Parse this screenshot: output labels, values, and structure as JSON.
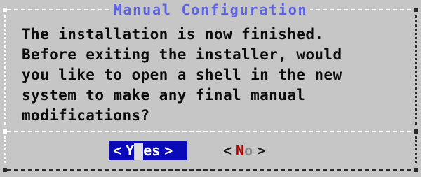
{
  "dialog": {
    "title": "Manual Configuration",
    "message": "The installation is now finished.\nBefore exiting the installer, would\nyou like to open a shell in the new\nsystem to make any final manual\nmodifications?"
  },
  "buttons": {
    "yes": {
      "left_bracket": "<",
      "hotkey": "Y",
      "rest": "es",
      "right_bracket": ">",
      "selected": true
    },
    "no": {
      "left_bracket": "<",
      "hotkey": "N",
      "rest": "o",
      "right_bracket": ">",
      "selected": false
    }
  },
  "colors": {
    "background": "#c6c6c6",
    "title": "#5b62e6",
    "selected_button_bg": "#0a0ab8",
    "hotkey": "#b00000"
  }
}
